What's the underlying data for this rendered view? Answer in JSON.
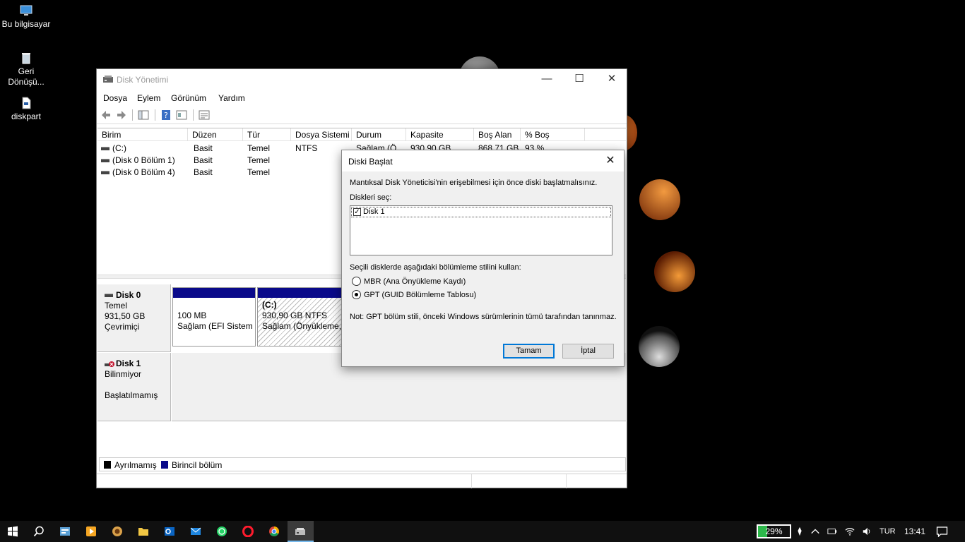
{
  "desktop": {
    "icons": [
      {
        "label": "Bu bilgisayar"
      },
      {
        "label": "Geri Dönüşü..."
      },
      {
        "label": "diskpart"
      }
    ]
  },
  "window": {
    "title": "Disk Yönetimi",
    "controls": {
      "minimize": "—",
      "maximize": "☐",
      "close": "✕"
    },
    "menu": [
      "Dosya",
      "Eylem",
      "Görünüm",
      "Yardım"
    ],
    "columns": [
      "Birim",
      "Düzen",
      "Tür",
      "Dosya Sistemi",
      "Durum",
      "Kapasite",
      "Boş Alan",
      "% Boş"
    ],
    "volumes": [
      {
        "name": "(C:)",
        "layout": "Basit",
        "type": "Temel",
        "fs": "NTFS",
        "status": "Sağlam (Ö...",
        "capacity": "930,90 GB",
        "free": "868,71 GB",
        "pct": "93 %"
      },
      {
        "name": "(Disk 0 Bölüm 1)",
        "layout": "Basit",
        "type": "Temel",
        "fs": "",
        "status": "",
        "capacity": "",
        "free": "",
        "pct": ""
      },
      {
        "name": "(Disk 0 Bölüm 4)",
        "layout": "Basit",
        "type": "Temel",
        "fs": "",
        "status": "",
        "capacity": "",
        "free": "",
        "pct": ""
      }
    ],
    "disks": [
      {
        "name": "Disk 0",
        "kind": "Temel",
        "size": "931,50 GB",
        "state": "Çevrimiçi",
        "partitions": [
          {
            "line1": "100 MB",
            "line2": "Sağlam (EFI Sistem B"
          },
          {
            "line1": "(C:)",
            "line2": "930,90 GB NTFS",
            "line3": "Sağlam (Önyükleme, S"
          }
        ]
      },
      {
        "name": "Disk 1",
        "kind": "Bilinmiyor",
        "state": "Başlatılmamış"
      }
    ],
    "legend": [
      {
        "label": "Ayrılmamış",
        "color": "#000000"
      },
      {
        "label": "Birincil bölüm",
        "color": "#0a0a8a"
      }
    ]
  },
  "dialog": {
    "title": "Diski Başlat",
    "close": "✕",
    "intro": "Mantıksal Disk Yöneticisi'nin erişebilmesi için önce diski başlatmalısınız.",
    "select_label": "Diskleri seç:",
    "disks": [
      {
        "label": "Disk 1",
        "checked": true,
        "check_mark": "✓"
      }
    ],
    "style_label": "Seçili disklerde aşağıdaki bölümleme stilini kullan:",
    "options": [
      {
        "label": "MBR (Ana Önyükleme Kaydı)",
        "selected": false
      },
      {
        "label": "GPT (GUID Bölümleme Tablosu)",
        "selected": true
      }
    ],
    "note": "Not: GPT bölüm stili, önceki Windows sürümlerinin tümü tarafından tanınmaz.",
    "ok_label": "Tamam",
    "cancel_label": "İptal"
  },
  "taskbar": {
    "battery_pct": "29%",
    "battery_level": 0.29,
    "language": "TUR",
    "time": "13:41",
    "accent": "#2db84b"
  }
}
